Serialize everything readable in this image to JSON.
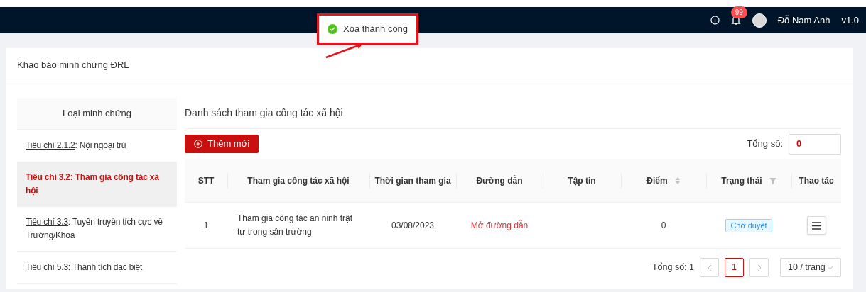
{
  "header": {
    "notification_count": "99",
    "user_name": "Đỗ Nam Anh",
    "version": "v1.0"
  },
  "toast": {
    "message": "Xóa thành công",
    "highlighted": true
  },
  "page_title": "Khao báo minh chứng ĐRL",
  "sidebar": {
    "heading": "Loại minh chứng",
    "items": [
      {
        "code": "Tiêu chí 2.1.2",
        "title": ": Nội ngoại trú",
        "selected": false
      },
      {
        "code": "Tiêu chí 3.2",
        "title": ": Tham gia công tác xã hội",
        "selected": true
      },
      {
        "code": "Tiêu chí 3.3",
        "title": ": Tuyên truyền tích cực về Trường/Khoa",
        "selected": false
      },
      {
        "code": "Tiêu chí 5.3",
        "title": ": Thành tích đặc biệt",
        "selected": false
      }
    ]
  },
  "list_title": "Danh sách tham gia công tác xã hội",
  "add_button": "Thêm mới",
  "total": {
    "label": "Tổng số:",
    "value": "0"
  },
  "table": {
    "columns": [
      {
        "label": "STT",
        "kind": "plain"
      },
      {
        "label": "Tham gia công tác xã hội",
        "kind": "plain"
      },
      {
        "label": "Thời gian tham gia",
        "kind": "plain"
      },
      {
        "label": "Đường dẫn",
        "kind": "plain"
      },
      {
        "label": "Tập tin",
        "kind": "plain"
      },
      {
        "label": "Điểm",
        "kind": "sort"
      },
      {
        "label": "Trạng thái",
        "kind": "filter"
      },
      {
        "label": "Thao tác",
        "kind": "plain"
      }
    ],
    "rows": [
      {
        "stt": "1",
        "activity": "Tham gia công tác an ninh trật tự trong sân trường",
        "date": "03/08/2023",
        "link": "Mở đường dẫn",
        "score": "0",
        "status": "Chờ duyệt"
      }
    ]
  },
  "pagination": {
    "total": "Tổng số: 1",
    "pages": [
      {
        "label": "1",
        "selected": true
      }
    ],
    "page_size": "10 / trang"
  }
}
